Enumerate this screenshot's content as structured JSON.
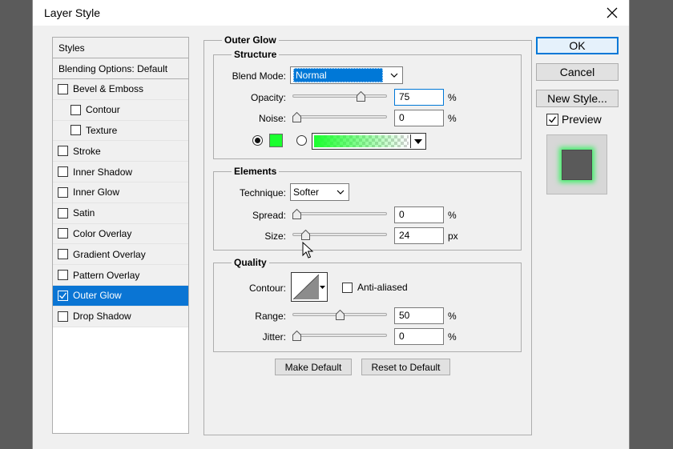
{
  "window": {
    "title": "Layer Style"
  },
  "styles_panel": {
    "header": "Styles",
    "blending_options": "Blending Options: Default",
    "items": [
      {
        "label": "Bevel & Emboss",
        "checked": false,
        "indent": false
      },
      {
        "label": "Contour",
        "checked": false,
        "indent": true
      },
      {
        "label": "Texture",
        "checked": false,
        "indent": true
      },
      {
        "label": "Stroke",
        "checked": false,
        "indent": false
      },
      {
        "label": "Inner Shadow",
        "checked": false,
        "indent": false
      },
      {
        "label": "Inner Glow",
        "checked": false,
        "indent": false
      },
      {
        "label": "Satin",
        "checked": false,
        "indent": false
      },
      {
        "label": "Color Overlay",
        "checked": false,
        "indent": false
      },
      {
        "label": "Gradient Overlay",
        "checked": false,
        "indent": false
      },
      {
        "label": "Pattern Overlay",
        "checked": false,
        "indent": false
      },
      {
        "label": "Outer Glow",
        "checked": true,
        "indent": false,
        "selected": true
      },
      {
        "label": "Drop Shadow",
        "checked": false,
        "indent": false
      }
    ]
  },
  "main": {
    "title": "Outer Glow",
    "structure": {
      "legend": "Structure",
      "blend_mode_label": "Blend Mode:",
      "blend_mode_value": "Normal",
      "opacity_label": "Opacity:",
      "opacity_value": "75",
      "opacity_unit": "%",
      "opacity_fraction": 0.75,
      "noise_label": "Noise:",
      "noise_value": "0",
      "noise_unit": "%",
      "noise_fraction": 0.0,
      "glow_color": "#1aff2e"
    },
    "elements": {
      "legend": "Elements",
      "technique_label": "Technique:",
      "technique_value": "Softer",
      "spread_label": "Spread:",
      "spread_value": "0",
      "spread_unit": "%",
      "spread_fraction": 0.0,
      "size_label": "Size:",
      "size_value": "24",
      "size_unit": "px",
      "size_fraction": 0.1
    },
    "quality": {
      "legend": "Quality",
      "contour_label": "Contour:",
      "anti_aliased_label": "Anti-aliased",
      "anti_aliased_checked": false,
      "range_label": "Range:",
      "range_value": "50",
      "range_unit": "%",
      "range_fraction": 0.5,
      "jitter_label": "Jitter:",
      "jitter_value": "0",
      "jitter_unit": "%",
      "jitter_fraction": 0.0
    },
    "make_default": "Make Default",
    "reset_default": "Reset to Default"
  },
  "actions": {
    "ok": "OK",
    "cancel": "Cancel",
    "new_style": "New Style...",
    "preview_label": "Preview",
    "preview_checked": true
  }
}
